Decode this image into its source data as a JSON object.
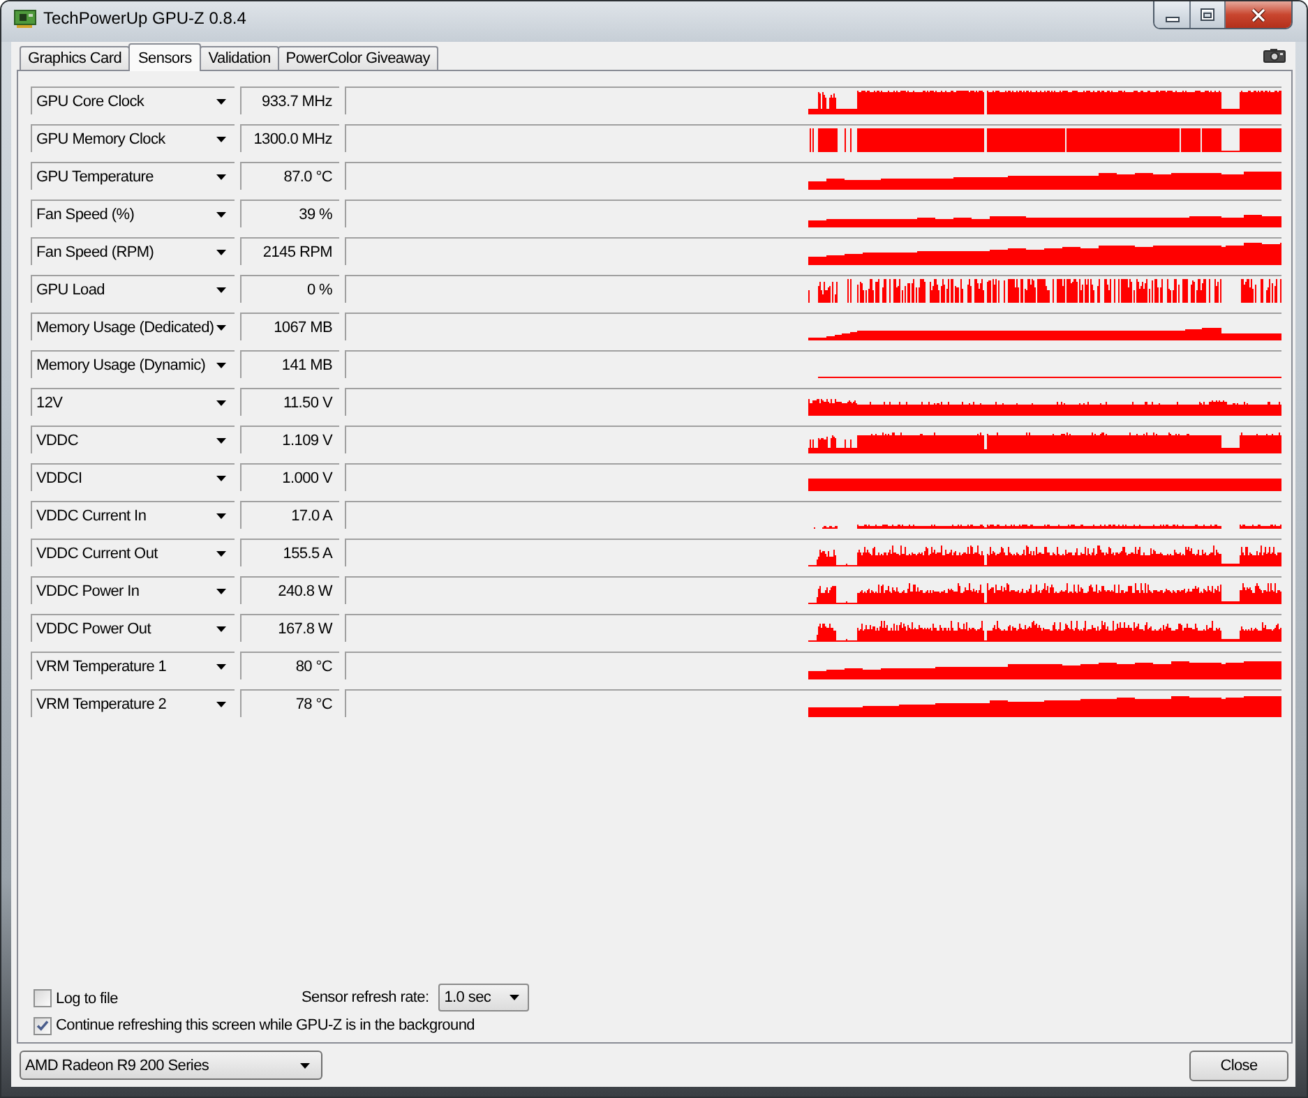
{
  "window": {
    "title": "TechPowerUp GPU-Z 0.8.4"
  },
  "tabs": [
    {
      "label": "Graphics Card",
      "selected": false
    },
    {
      "label": "Sensors",
      "selected": true
    },
    {
      "label": "Validation",
      "selected": false
    },
    {
      "label": "PowerColor Giveaway",
      "selected": false
    }
  ],
  "sensors": [
    {
      "name": "GPU Core Clock",
      "value": "933.7 MHz",
      "kind": "clock"
    },
    {
      "name": "GPU Memory Clock",
      "value": "1300.0 MHz",
      "kind": "binary"
    },
    {
      "name": "GPU Temperature",
      "value": "87.0 °C",
      "kind": "rising"
    },
    {
      "name": "Fan Speed (%)",
      "value": "39 %",
      "kind": "gentle"
    },
    {
      "name": "Fan Speed (RPM)",
      "value": "2145 RPM",
      "kind": "rising"
    },
    {
      "name": "GPU Load",
      "value": "0 %",
      "kind": "bars"
    },
    {
      "name": "Memory Usage (Dedicated)",
      "value": "1067 MB",
      "kind": "step"
    },
    {
      "name": "Memory Usage (Dynamic)",
      "value": "141 MB",
      "kind": "line"
    },
    {
      "name": "12V",
      "value": "11.50 V",
      "kind": "ripple"
    },
    {
      "name": "VDDC",
      "value": "1.109 V",
      "kind": "vclock"
    },
    {
      "name": "VDDCI",
      "value": "1.000 V",
      "kind": "flat"
    },
    {
      "name": "VDDC Current In",
      "value": "17.0 A",
      "kind": "blips"
    },
    {
      "name": "VDDC Current Out",
      "value": "155.5 A",
      "kind": "spiky"
    },
    {
      "name": "VDDC Power In",
      "value": "240.8 W",
      "kind": "spiky"
    },
    {
      "name": "VDDC Power Out",
      "value": "167.8 W",
      "kind": "spiky"
    },
    {
      "name": "VRM Temperature 1",
      "value": "80 °C",
      "kind": "rising"
    },
    {
      "name": "VRM Temperature 2",
      "value": "78 °C",
      "kind": "rising"
    }
  ],
  "log_to_file": {
    "label": "Log to file",
    "checked": false
  },
  "refresh_rate": {
    "label": "Sensor refresh rate:",
    "value": "1.0 sec"
  },
  "background_refresh": {
    "label": "Continue refreshing this screen while GPU-Z is in the background",
    "checked": true
  },
  "gpu_select": {
    "value": "AMD Radeon R9 200 Series"
  },
  "close_button": {
    "label": "Close"
  }
}
